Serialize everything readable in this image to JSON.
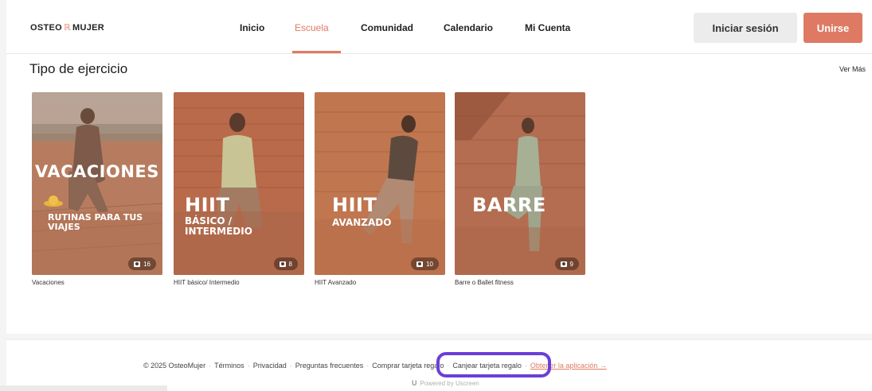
{
  "header": {
    "logo_left": "OSTEO",
    "logo_mark": "ℝ",
    "logo_right": "MUJER",
    "nav": [
      "Inicio",
      "Escuela",
      "Comunidad",
      "Calendario",
      "Mi Cuenta"
    ],
    "active_nav": "Escuela",
    "login_label": "Iniciar sesión",
    "join_label": "Unirse",
    "accent_color": "#de7a63"
  },
  "section": {
    "title": "Tipo de ejercicio",
    "see_more": "Ver Más"
  },
  "cards": [
    {
      "label": "Vacaciones",
      "overlay_title": "VACACIONES",
      "overlay_sub": "RUTINAS PARA TUS VIAJES",
      "count": "16"
    },
    {
      "label": "HIIT básico/ Intermedio",
      "overlay_title": "HIIT",
      "overlay_sub": "BÁSICO / INTERMEDIO",
      "count": "8"
    },
    {
      "label": "HIIT Avanzado",
      "overlay_title": "HIIT",
      "overlay_sub": "AVANZADO",
      "count": "10"
    },
    {
      "label": "Barre o Ballet fitness",
      "overlay_title": "BARRE",
      "overlay_sub": "",
      "count": "9"
    }
  ],
  "footer": {
    "copyright": "© 2025 OsteoMujer",
    "links": [
      "Términos",
      "Privacidad",
      "Preguntas frecuentes",
      "Comprar tarjeta regalo",
      "Canjear tarjeta regalo"
    ],
    "app_link": "Obtener la aplicación →",
    "powered_by": "Powered by Uscreen"
  }
}
